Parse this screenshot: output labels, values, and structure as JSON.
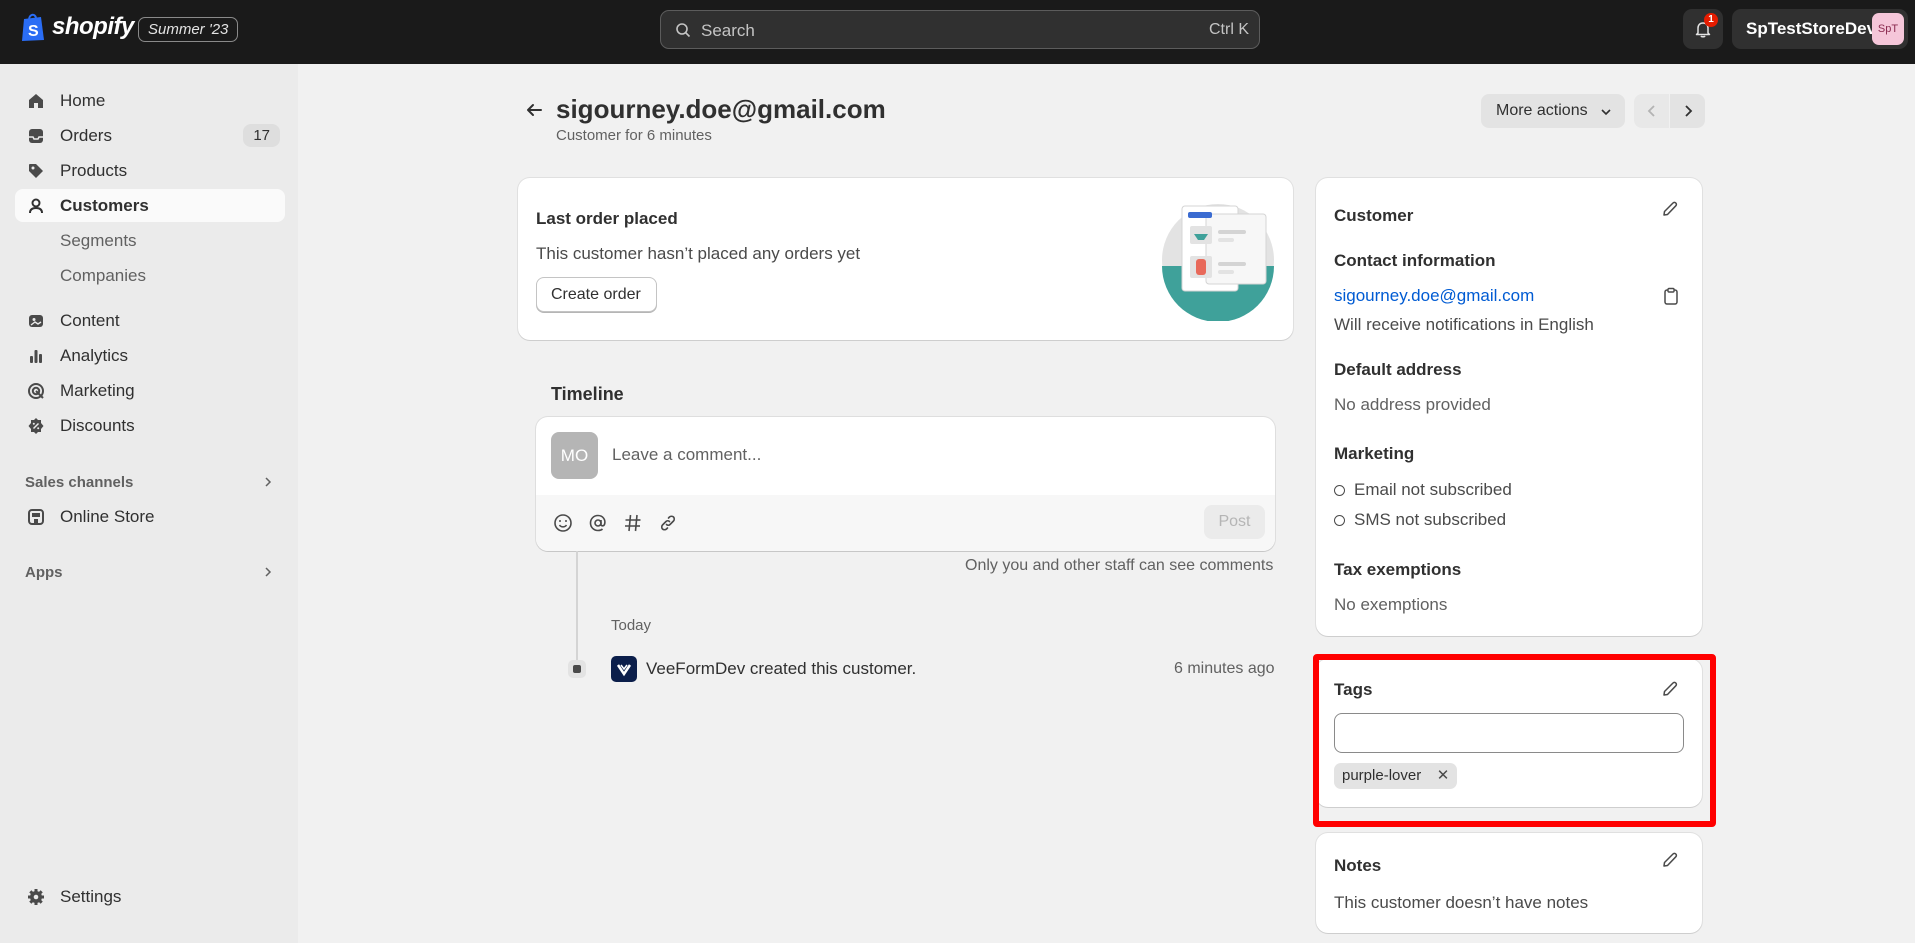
{
  "topbar": {
    "brand": "shopify",
    "edition": "Summer '23",
    "search_placeholder": "Search",
    "search_shortcut": "Ctrl K",
    "notification_count": "1",
    "store_name": "SpTestStoreDev",
    "store_initials": "SpT"
  },
  "sidebar": {
    "items": [
      {
        "label": "Home",
        "icon": "home-icon"
      },
      {
        "label": "Orders",
        "icon": "inbox-icon",
        "count": "17"
      },
      {
        "label": "Products",
        "icon": "tag-icon"
      },
      {
        "label": "Customers",
        "icon": "person-icon",
        "active": true
      },
      {
        "label": "Segments"
      },
      {
        "label": "Companies"
      },
      {
        "label": "Content",
        "icon": "content-icon"
      },
      {
        "label": "Analytics",
        "icon": "bar-chart-icon"
      },
      {
        "label": "Marketing",
        "icon": "target-icon"
      },
      {
        "label": "Discounts",
        "icon": "discount-icon"
      }
    ],
    "sales_channels_label": "Sales channels",
    "online_store_label": "Online Store",
    "apps_label": "Apps",
    "settings_label": "Settings"
  },
  "page": {
    "title": "sigourney.doe@gmail.com",
    "subtitle": "Customer for 6 minutes",
    "more_actions_label": "More actions"
  },
  "last_order": {
    "heading": "Last order placed",
    "text": "This customer hasn’t placed any orders yet",
    "button": "Create order"
  },
  "timeline": {
    "heading": "Timeline",
    "avatar_initials": "MO",
    "comment_placeholder": "Leave a comment...",
    "post_label": "Post",
    "privacy_note": "Only you and other staff can see comments",
    "date_group": "Today",
    "event_text": "VeeFormDev created this customer.",
    "event_time": "6 minutes ago"
  },
  "customer_card": {
    "heading": "Customer",
    "contact_heading": "Contact information",
    "email": "sigourney.doe@gmail.com",
    "language_note": "Will receive notifications in English",
    "address_heading": "Default address",
    "address_value": "No address provided",
    "marketing_heading": "Marketing",
    "email_marketing": "Email not subscribed",
    "sms_marketing": "SMS not subscribed",
    "tax_heading": "Tax exemptions",
    "tax_value": "No exemptions"
  },
  "tags_card": {
    "heading": "Tags",
    "input_value": "",
    "tags": [
      "purple-lover"
    ]
  },
  "notes_card": {
    "heading": "Notes",
    "text": "This customer doesn’t have notes"
  },
  "colors": {
    "topbar": "#1a1a1a",
    "link": "#005bd3",
    "highlight": "#ff0000",
    "illustration_teal": "#3fa19a"
  }
}
